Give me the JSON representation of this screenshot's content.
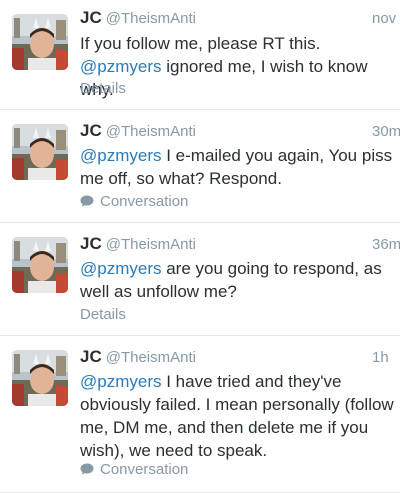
{
  "colors": {
    "link": "#2b7bb9",
    "muted": "#8899a6",
    "text": "#292f33",
    "divider": "#e1e8ed"
  },
  "tweets": [
    {
      "fullname": "JC",
      "username": "@TheismAnti",
      "time": "nov",
      "text_parts": [
        "If you follow me, please RT this. ",
        "@pzmyers",
        " ignored me, I wish to know why."
      ],
      "footer": "Details",
      "footer_icon": ""
    },
    {
      "fullname": "JC",
      "username": "@TheismAnti",
      "time": "30m",
      "text_parts": [
        "",
        "@pzmyers",
        " I e-mailed you again, You piss me off, so what? Respond."
      ],
      "footer": "Conversation",
      "footer_icon": "conversation-bubble-icon"
    },
    {
      "fullname": "JC",
      "username": "@TheismAnti",
      "time": "36m",
      "text_parts": [
        "",
        "@pzmyers",
        " are you going to respond, as well as unfollow me?"
      ],
      "footer": "Details",
      "footer_icon": ""
    },
    {
      "fullname": "JC",
      "username": "@TheismAnti",
      "time": "1h",
      "text_parts": [
        "",
        "@pzmyers",
        " I have tried and they've obviously failed. I mean personally (follow me, DM me, and then delete me if you wish), we need to speak."
      ],
      "footer": "Conversation",
      "footer_icon": "conversation-bubble-icon"
    }
  ]
}
